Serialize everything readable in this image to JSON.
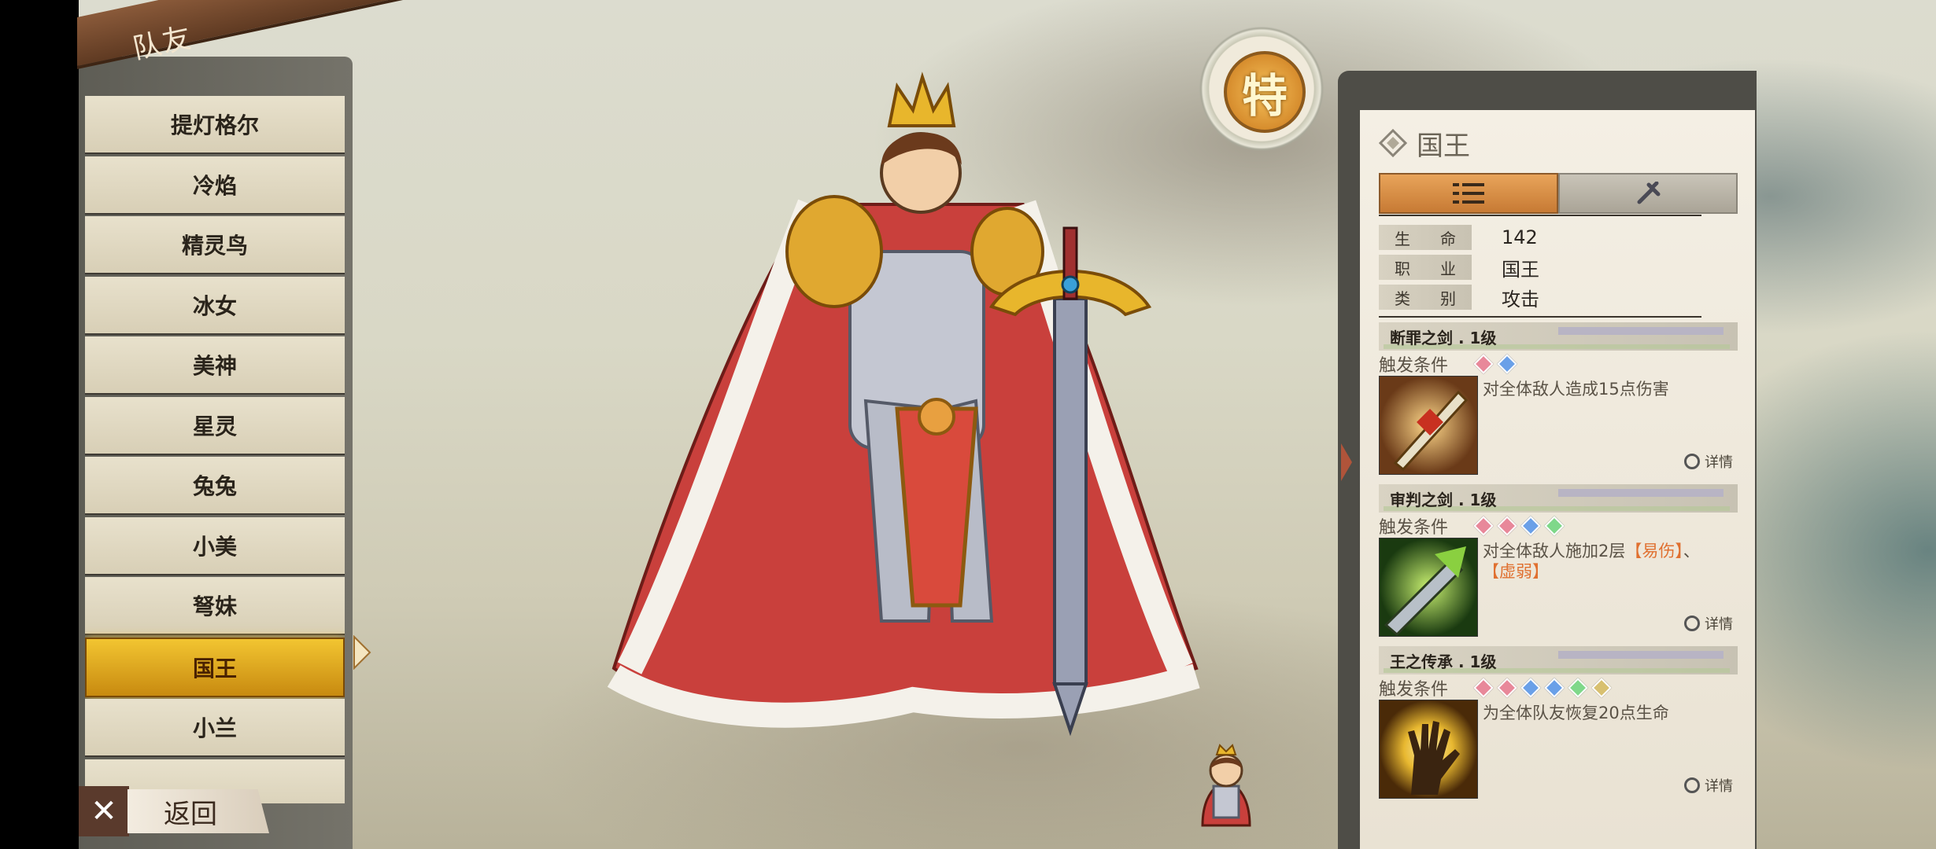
{
  "header": {
    "tab_label": "队友"
  },
  "roster": {
    "items": [
      {
        "label": "提灯格尔"
      },
      {
        "label": "冷焰"
      },
      {
        "label": "精灵鸟"
      },
      {
        "label": "冰女"
      },
      {
        "label": "美神"
      },
      {
        "label": "星灵"
      },
      {
        "label": "兔兔"
      },
      {
        "label": "小美"
      },
      {
        "label": "弩妹"
      },
      {
        "label": "国王",
        "selected": true
      },
      {
        "label": "小兰"
      }
    ]
  },
  "back": {
    "label": "返回",
    "close_icon": "close-icon"
  },
  "badge": {
    "label": "特"
  },
  "detail": {
    "name": "国王",
    "tabs": [
      {
        "icon": "list-icon",
        "active": true
      },
      {
        "icon": "wrench-icon",
        "active": false
      }
    ],
    "stats": [
      {
        "k1": "生",
        "k2": "命",
        "value": "142"
      },
      {
        "k1": "职",
        "k2": "业",
        "value": "国王"
      },
      {
        "k1": "类",
        "k2": "别",
        "value": "攻击"
      }
    ],
    "trigger_label": "触发条件",
    "detail_label": "详情",
    "skills": [
      {
        "name": "断罪之剑 . 1级",
        "gems": [
          "#e8889a",
          "#6aa0e8"
        ],
        "desc": "对全体敌人造成15点伤害",
        "desc_hl1": "",
        "desc_mid": "",
        "desc_hl2": ""
      },
      {
        "name": "审判之剑 . 1级",
        "gems": [
          "#e8889a",
          "#e8889a",
          "#6aa0e8",
          "#7fd88a"
        ],
        "desc": "对全体敌人施加2层",
        "desc_hl1": "【易伤】",
        "desc_mid": "、",
        "desc_hl2": "【虚弱】"
      },
      {
        "name": "王之传承 . 1级",
        "gems": [
          "#e8889a",
          "#e8889a",
          "#6aa0e8",
          "#6aa0e8",
          "#7fd88a",
          "#d8c070"
        ],
        "desc": "为全体队友恢复20点生命",
        "desc_hl1": "",
        "desc_mid": "",
        "desc_hl2": ""
      }
    ]
  },
  "colors": {
    "selected": "#f2c531",
    "accent": "#e07030"
  }
}
